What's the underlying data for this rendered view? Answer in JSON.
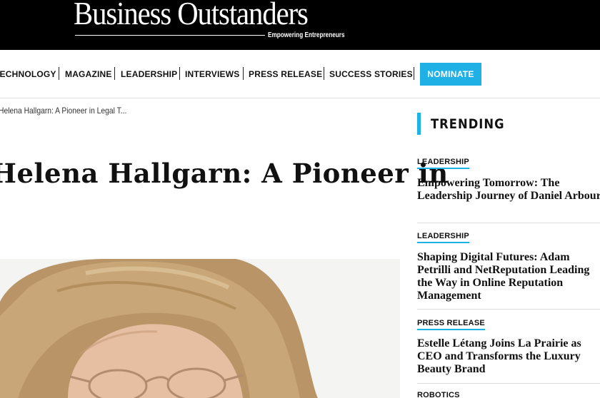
{
  "header": {
    "logo_text": "Business Outstanders",
    "logo_tagline": "Empowering Entrepreneurs"
  },
  "nav": {
    "items": [
      "TECHNOLOGY",
      "MAGAZINE",
      "LEADERSHIP",
      "INTERVIEWS",
      "PRESS RELEASE",
      "SUCCESS STORIES"
    ],
    "cta": "NOMINATE"
  },
  "article": {
    "breadcrumb": "Helena Hallgarn: A Pioneer in Legal T...",
    "title": "Helena Hallgarn: A Pioneer in"
  },
  "sidebar": {
    "heading": "TRENDING",
    "items": [
      {
        "category": "LEADERSHIP",
        "headline": "Empowering Tomorrow: The Leadership Journey of Daniel Arbour"
      },
      {
        "category": "LEADERSHIP",
        "headline": "Shaping Digital Futures: Adam Petrilli and NetReputation Leading the Way in Online Reputation Management"
      },
      {
        "category": "PRESS RELEASE",
        "headline": "Estelle Létang Joins La Prairie as CEO and Transforms the Luxury Beauty Brand"
      },
      {
        "category": "ROBOTICS",
        "headline": ""
      }
    ]
  },
  "colors": {
    "accent": "#1fb0e6",
    "header_bg": "#000000"
  }
}
